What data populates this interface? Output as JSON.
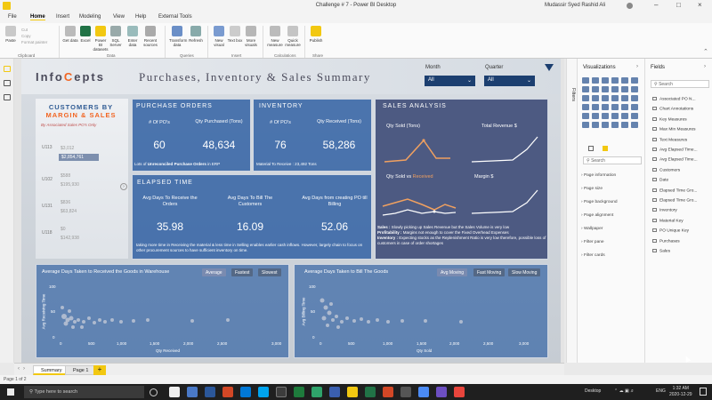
{
  "window": {
    "title": "Challenge # 7 - Power BI Desktop",
    "user": "Mudassir Syed Rashid Ali"
  },
  "menu": [
    "File",
    "Home",
    "Insert",
    "Modeling",
    "View",
    "Help",
    "External Tools"
  ],
  "ribbon": {
    "buttons": [
      "Paste",
      "Get data",
      "Excel",
      "Power BI datasets",
      "SQL Server",
      "Enter data",
      "Recent sources",
      "Transform data",
      "Refresh",
      "New visual",
      "Text box",
      "More visuals",
      "New measure",
      "Quick measure",
      "Publish"
    ],
    "small": [
      "Cut",
      "Copy",
      "Format painter"
    ],
    "groups": [
      "Clipboard",
      "Data",
      "Queries",
      "Insert",
      "Calculations",
      "Share"
    ]
  },
  "report": {
    "logo_pre": "Info",
    "logo_hi": "C",
    "logo_post": "epts",
    "title": "Purchases, Inventory & Sales Summary",
    "slicers": [
      {
        "label": "Month",
        "value": "All"
      },
      {
        "label": "Quarter",
        "value": "All"
      }
    ],
    "customers": {
      "title1": "Customers by",
      "title2": "Margin & Sales",
      "subtitle": "By Associated Sales PO's Only",
      "rows": [
        {
          "id": "U113",
          "v1": "$3,012",
          "v2": "$2,854,761"
        },
        {
          "id": "U102",
          "v1": "$588",
          "v2": "$195,930"
        },
        {
          "id": "U131",
          "v1": "$836",
          "v2": "$63,824"
        },
        {
          "id": "U118",
          "v1": "$0",
          "v2": "$142,938"
        }
      ]
    },
    "purchase_orders": {
      "title": "Purchase Orders",
      "l1": "# Of PO's",
      "v1": "60",
      "l2": "Qty Purchased (Tons)",
      "v2": "48,634",
      "note_pre": "Lots of",
      "note_b1": "Unreconciled",
      "note_b2": "Purchase Orders",
      "note_post": "in ERP"
    },
    "inventory": {
      "title": "Inventory",
      "l1": "# Of PO's",
      "v1": "76",
      "l2": "Qty Received (Tons)",
      "v2": "58,286",
      "note": "Material To Receive : 23,492 Tons"
    },
    "elapsed": {
      "title": "Elapsed Time",
      "metrics": [
        {
          "label": "Avg Days To Receive the Orders",
          "value": "35.98"
        },
        {
          "label": "Avg Days To Bill The Customers",
          "value": "16.09"
        },
        {
          "label": "Avg Days from creating PO till Billing",
          "value": "52.06"
        }
      ],
      "note": "taking more time in Receiving the material & less time in Selling enables earlier cash inflows. However, largely chain to focus on other procurement sources to have sufficient inventory on time."
    },
    "sales": {
      "title": "Sales Analysis",
      "c1": "Qty Sold (Tons)",
      "c2": "Total Revenue $",
      "c3_pre": "Qty Sold vs",
      "c3_hi": "Received",
      "c4": "Margin $",
      "notes": [
        {
          "k": "Sales :",
          "t": "Slowly picking up Sales Revenue but the Sales Volume is very low"
        },
        {
          "k": "Profitability :",
          "t": "Margins not enough to cover the Fixed Overhead Expenses"
        },
        {
          "k": "Inventory :",
          "t": "Expecting stocks as the Replenishment Ratio is very low therefore, possible loss of customers in case of order shortages"
        }
      ]
    },
    "scatter1": {
      "title": "Average Days Taken to Received the Goods in Warehouse",
      "buttons": [
        "Average",
        "Fastest",
        "Slowest"
      ],
      "ylabel": "Avg Receiving Time",
      "xlabel": "Qty Received",
      "yticks": [
        "100",
        "50",
        "0"
      ],
      "xticks": [
        "0",
        "500",
        "1,000",
        "1,500",
        "2,000",
        "2,500",
        "3,000"
      ]
    },
    "scatter2": {
      "title": "Average Days Taken to Bill The Goods",
      "buttons": [
        "Avg Moving",
        "Fast Moving",
        "Slow Moving"
      ],
      "ylabel": "Avg Billing Time",
      "xlabel": "Qty Sold",
      "yticks": [
        "100",
        "50",
        "0"
      ],
      "xticks": [
        "0",
        "500",
        "1,000",
        "1,500",
        "2,000",
        "2,500",
        "3,000"
      ]
    }
  },
  "pages": {
    "tabs": [
      "Summary",
      "Page 1"
    ],
    "add": "+",
    "status": "Page 1 of 2"
  },
  "filters_label": "Filters",
  "viz": {
    "title": "Visualizations",
    "search": "Search",
    "format": [
      "Page information",
      "Page size",
      "Page background",
      "Page alignment",
      "Wallpaper",
      "Filter pane",
      "Filter cards"
    ]
  },
  "fields": {
    "title": "Fields",
    "search": "Search",
    "items": [
      "Associated PO N...",
      "Chart Annotations",
      "Key Measures",
      "Max Min Measures",
      "Text Measures",
      "Avg Elapsed Time...",
      "Avg Elapsed Time...",
      "Customers",
      "Date",
      "Elapsed Time Gro...",
      "Elapsed Time Gro...",
      "Inventory",
      "Material Key",
      "PO Unique Key",
      "Purchases",
      "Sales"
    ]
  },
  "taskbar": {
    "search": "Type here to search",
    "desktop": "Desktop",
    "lang": "ENG",
    "time": "1:32 AM",
    "date": "2020-12-29"
  }
}
